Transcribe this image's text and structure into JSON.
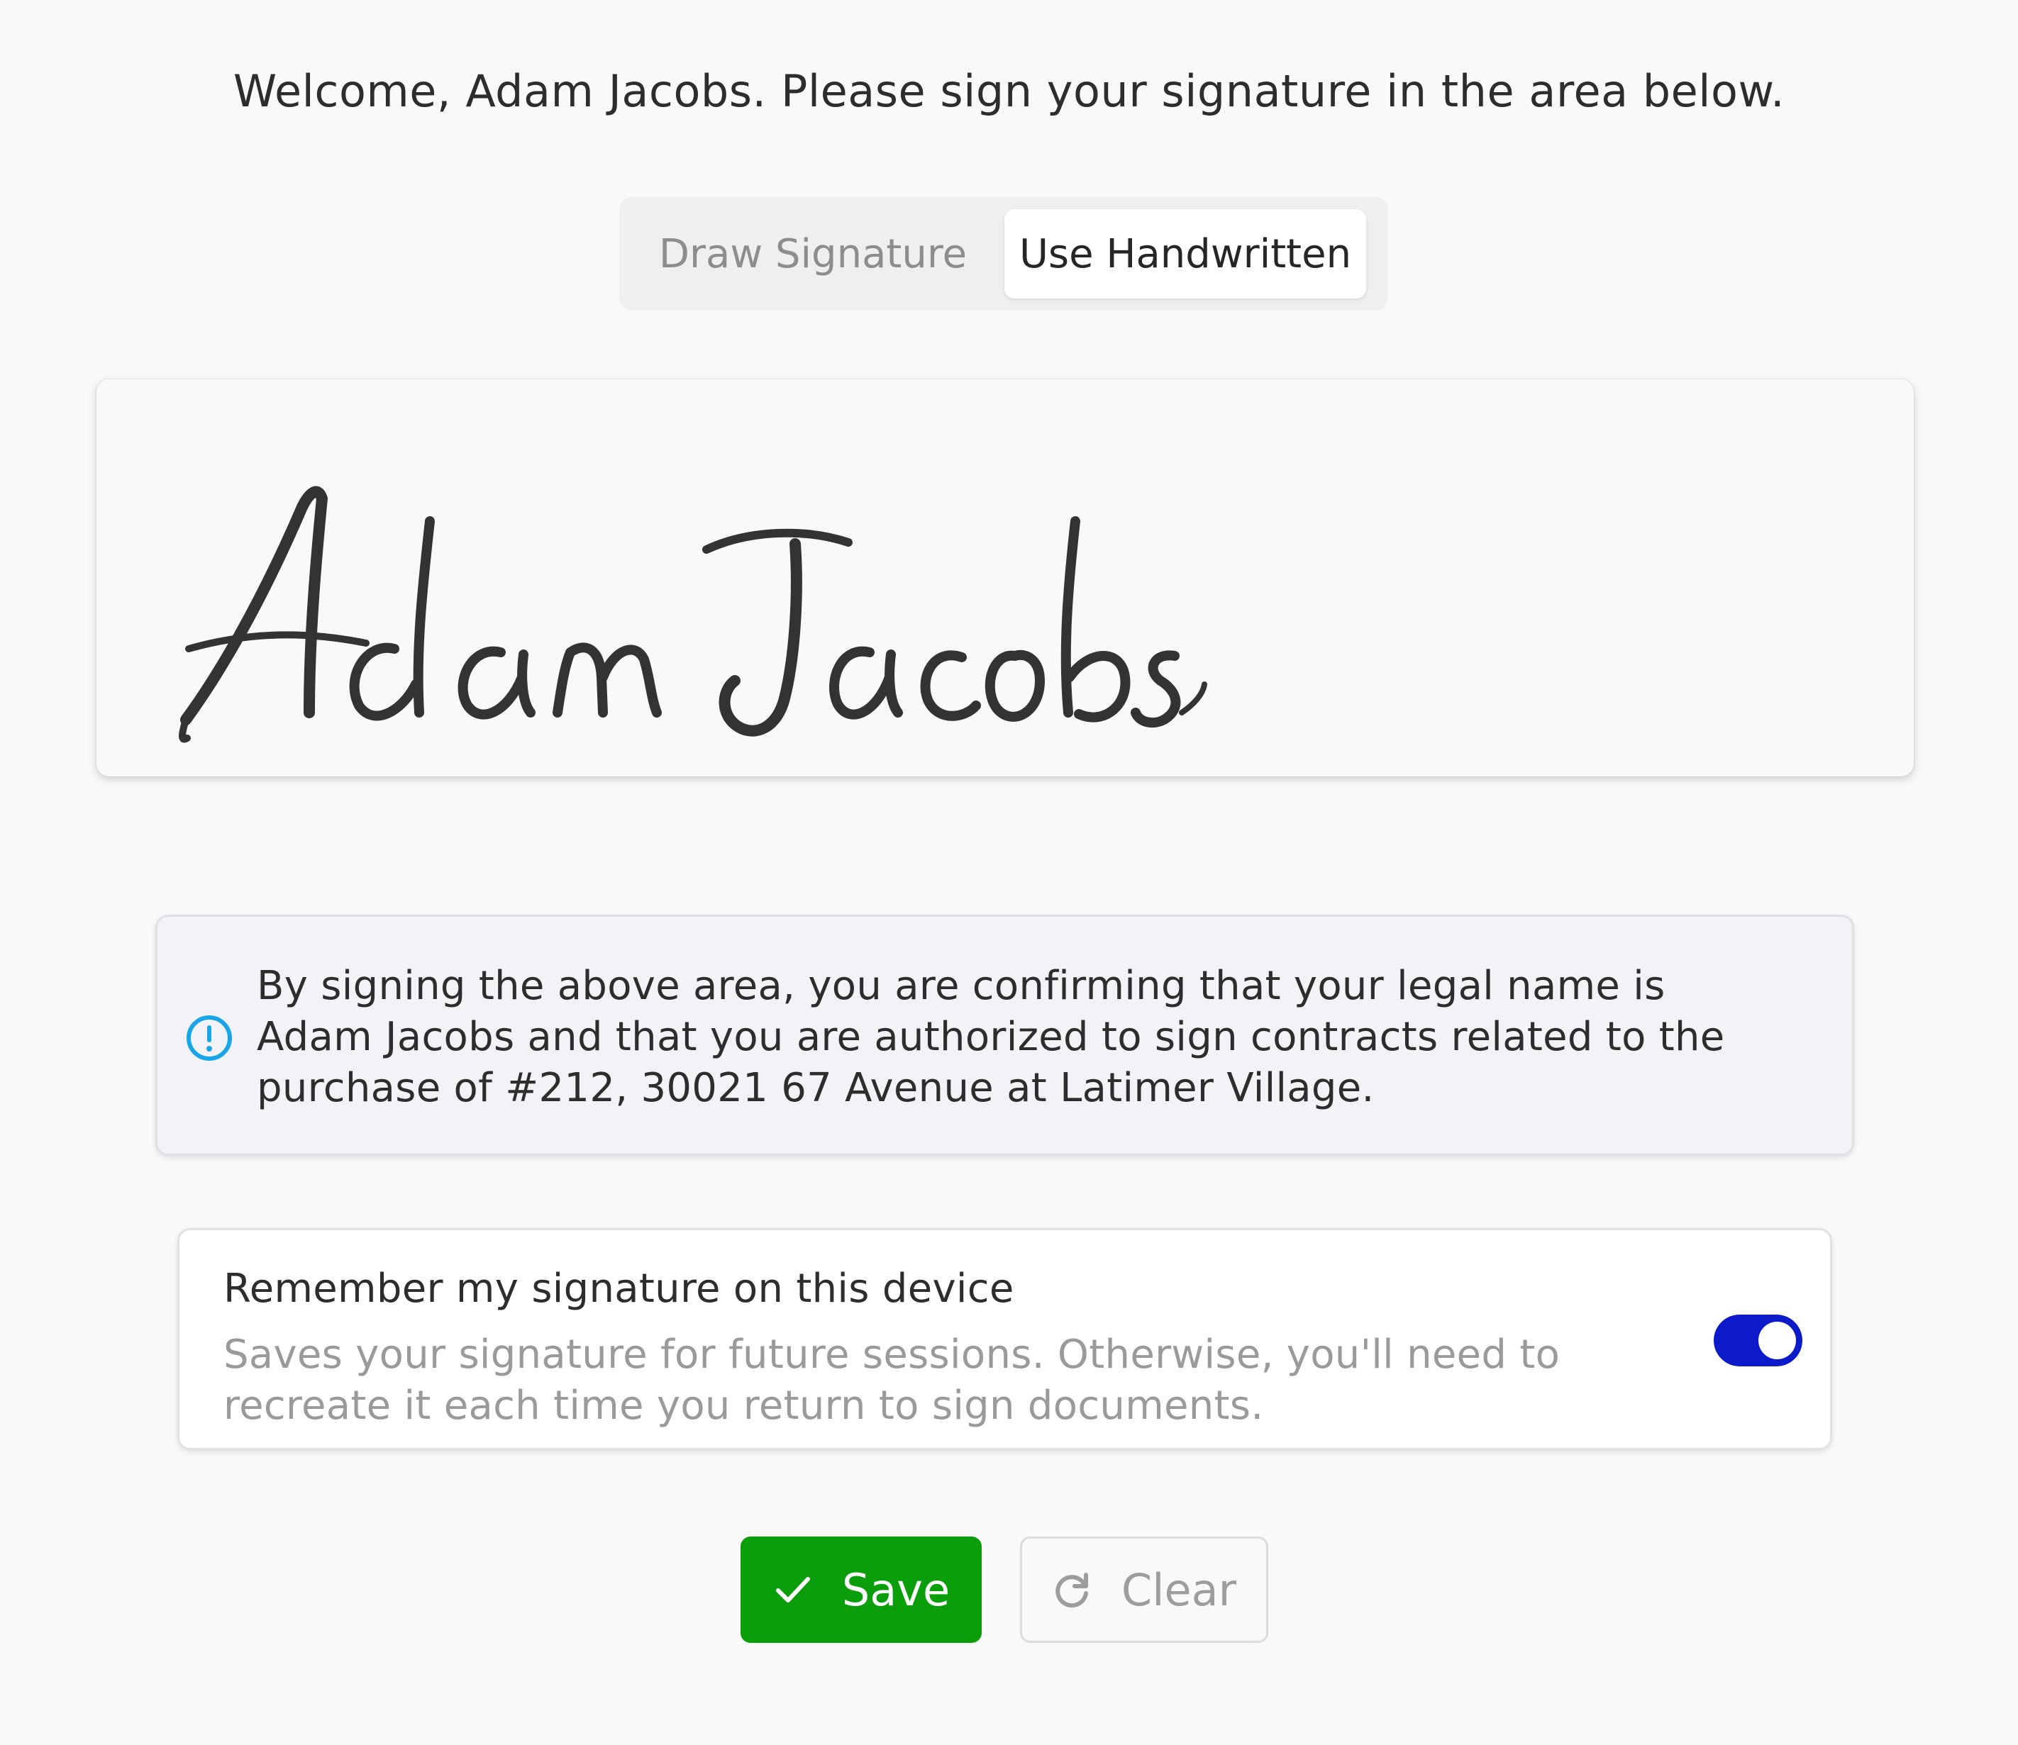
{
  "welcome": {
    "message": "Welcome, Adam Jacobs. Please sign your signature in the area below."
  },
  "signature_mode": {
    "options": [
      {
        "label": "Draw Signature",
        "selected": false
      },
      {
        "label": "Use Handwritten",
        "selected": true
      }
    ]
  },
  "signature": {
    "handwritten_text": "Adam Jacobs",
    "ink_color": "#333333"
  },
  "notice": {
    "icon": "info-circle-icon",
    "icon_color": "#1aa6e6",
    "text": "By signing the above area, you are confirming that your legal name is Adam Jacobs and that you are authorized to sign contracts related to the purchase of #212, 30021 67 Avenue at Latimer Village."
  },
  "remember": {
    "title": "Remember my signature on this device",
    "description": "Saves your signature for future sessions. Otherwise, you'll need to recreate it each time you return to sign documents.",
    "enabled": true,
    "toggle_color": "#0d1ac9"
  },
  "actions": {
    "save_label": "Save",
    "save_icon": "checkmark-icon",
    "save_color": "#0a9e0a",
    "clear_label": "Clear",
    "clear_icon": "refresh-icon"
  }
}
